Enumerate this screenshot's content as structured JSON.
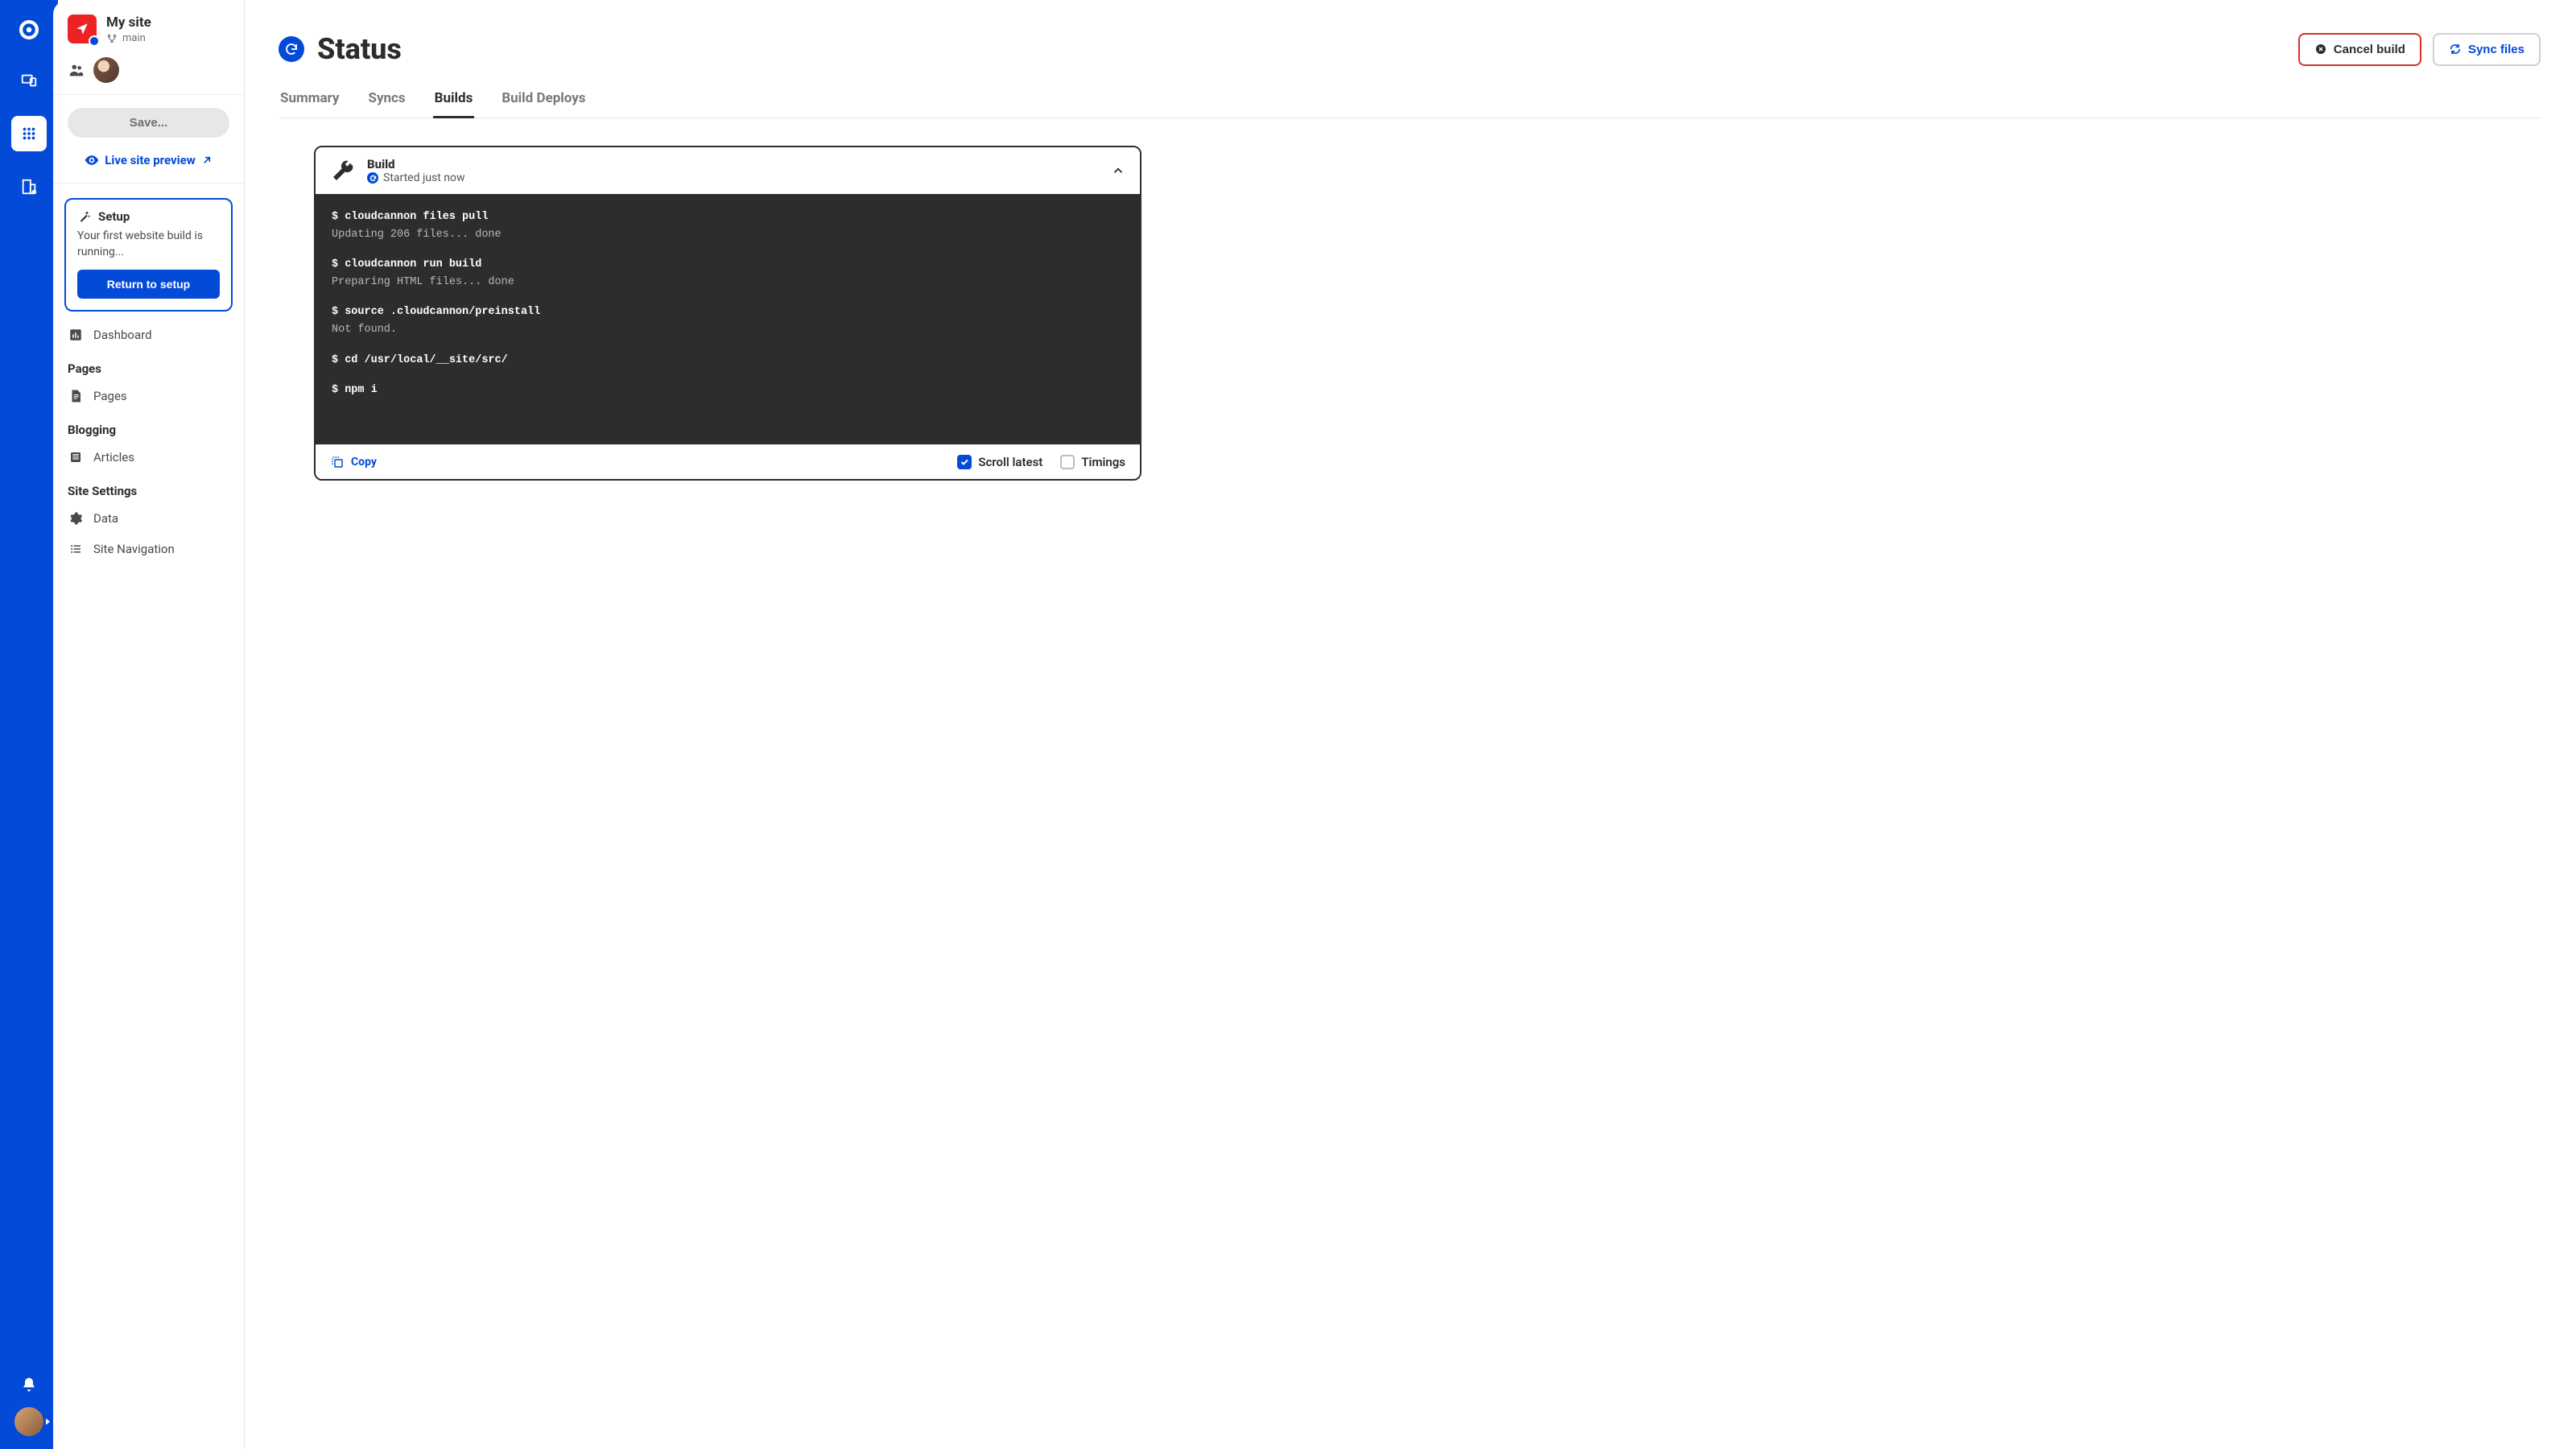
{
  "site": {
    "name": "My site",
    "branch": "main"
  },
  "sidebar": {
    "save_label": "Save...",
    "live_preview_label": "Live site preview",
    "setup": {
      "title": "Setup",
      "description": "Your first website build is running...",
      "button": "Return to setup"
    },
    "dashboard_label": "Dashboard",
    "sections": [
      {
        "label": "Pages",
        "items": [
          {
            "label": "Pages"
          }
        ]
      },
      {
        "label": "Blogging",
        "items": [
          {
            "label": "Articles"
          }
        ]
      },
      {
        "label": "Site Settings",
        "items": [
          {
            "label": "Data"
          },
          {
            "label": "Site Navigation"
          }
        ]
      }
    ]
  },
  "header": {
    "title": "Status",
    "cancel_label": "Cancel build",
    "sync_label": "Sync files"
  },
  "tabs": [
    "Summary",
    "Syncs",
    "Builds",
    "Build Deploys"
  ],
  "active_tab": "Builds",
  "build": {
    "title": "Build",
    "status_text": "Started just now",
    "terminal_blocks": [
      {
        "cmd": "$ cloudcannon files pull",
        "out": "Updating 206 files... done"
      },
      {
        "cmd": "$ cloudcannon run build",
        "out": "Preparing HTML files... done"
      },
      {
        "cmd": "$ source .cloudcannon/preinstall",
        "out": "Not found."
      },
      {
        "cmd": "$ cd /usr/local/__site/src/",
        "out": ""
      },
      {
        "cmd": "$ npm i",
        "out": ""
      }
    ],
    "footer": {
      "copy_label": "Copy",
      "scroll_latest_label": "Scroll latest",
      "timings_label": "Timings",
      "scroll_latest_checked": true,
      "timings_checked": false
    }
  }
}
